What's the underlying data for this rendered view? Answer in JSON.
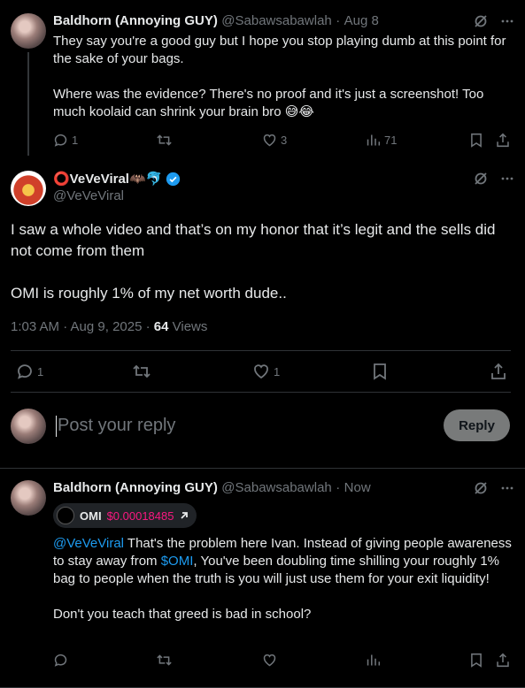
{
  "parent_tweet": {
    "name": "Baldhorn (Annoying GUY)",
    "handle": "@Sabawsabawlah",
    "sep": "·",
    "date": "Aug 8",
    "text_p1": "They say you're a good guy but I hope you stop playing dumb at this point for the sake of your bags.",
    "text_p2": "Where was the evidence? There's no proof and it's just a screenshot! Too much koolaid can shrink your brain bro 😅😂",
    "replies": "1",
    "retweets": "",
    "likes": "3",
    "views": "71"
  },
  "main_tweet": {
    "name": "⭕VeVeViral🦇🐬",
    "handle": "@VeVeViral",
    "text_p1": "I saw a whole video and that’s on my honor that it’s legit and the sells did not come from them",
    "text_p2": "OMI is roughly 1% of my net worth dude..",
    "time": "1:03 AM · Aug 9, 2025 · ",
    "views_count": "64",
    "views_label": " Views",
    "replies": "1",
    "likes": "1"
  },
  "reply_box": {
    "placeholder": "Post your reply",
    "button": "Reply"
  },
  "reply_tweet": {
    "name": "Baldhorn (Annoying GUY)",
    "handle": "@Sabawsabawlah",
    "sep": "·",
    "date": "Now",
    "token_name": "OMI",
    "token_price": "$0.00018485",
    "mention": "@VeVeViral",
    "text_a": " That's the problem here Ivan. Instead of giving people awareness to stay away from ",
    "cashtag": "$OMI",
    "text_b": ", You've been doubling time shilling your roughly 1% bag to people when the truth is you will just use them for your exit liquidity!",
    "text_p2": "Don't you teach that greed is bad in school?"
  },
  "colors": {
    "background": "#000000",
    "text": "#e7e9ea",
    "muted": "#71767b",
    "link": "#1d9bf0",
    "verified": "#1d9bf0",
    "price": "#f91880",
    "divider": "#2f3336",
    "reply_button_bg": "#787a7a"
  }
}
